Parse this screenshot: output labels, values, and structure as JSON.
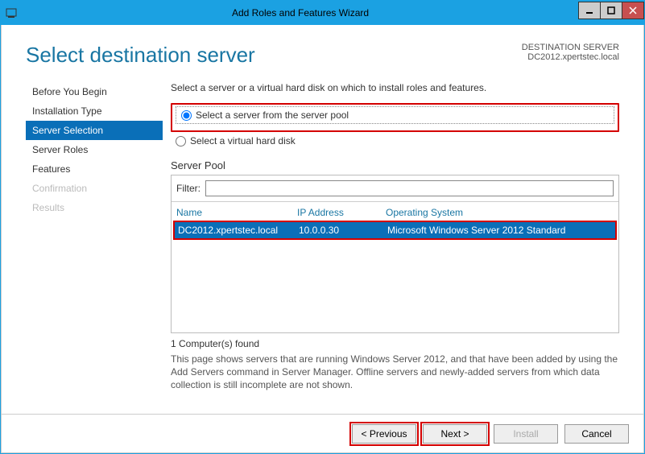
{
  "window": {
    "title": "Add Roles and Features Wizard"
  },
  "header": {
    "page_title": "Select destination server",
    "dest_label": "DESTINATION SERVER",
    "dest_value": "DC2012.xpertstec.local"
  },
  "sidebar": {
    "items": [
      {
        "label": "Before You Begin",
        "state": "normal"
      },
      {
        "label": "Installation Type",
        "state": "normal"
      },
      {
        "label": "Server Selection",
        "state": "active"
      },
      {
        "label": "Server Roles",
        "state": "normal"
      },
      {
        "label": "Features",
        "state": "normal"
      },
      {
        "label": "Confirmation",
        "state": "disabled"
      },
      {
        "label": "Results",
        "state": "disabled"
      }
    ]
  },
  "main": {
    "instruction": "Select a server or a virtual hard disk on which to install roles and features.",
    "radio1": "Select a server from the server pool",
    "radio2": "Select a virtual hard disk",
    "section_label": "Server Pool",
    "filter_label": "Filter:",
    "filter_value": "",
    "columns": {
      "name": "Name",
      "ip": "IP Address",
      "os": "Operating System"
    },
    "rows": [
      {
        "name": "DC2012.xpertstec.local",
        "ip": "10.0.0.30",
        "os": "Microsoft Windows Server 2012 Standard"
      }
    ],
    "found_text": "1 Computer(s) found",
    "help_text": "This page shows servers that are running Windows Server 2012, and that have been added by using the Add Servers command in Server Manager. Offline servers and newly-added servers from which data collection is still incomplete are not shown."
  },
  "footer": {
    "previous": "< Previous",
    "next": "Next >",
    "install": "Install",
    "cancel": "Cancel"
  }
}
